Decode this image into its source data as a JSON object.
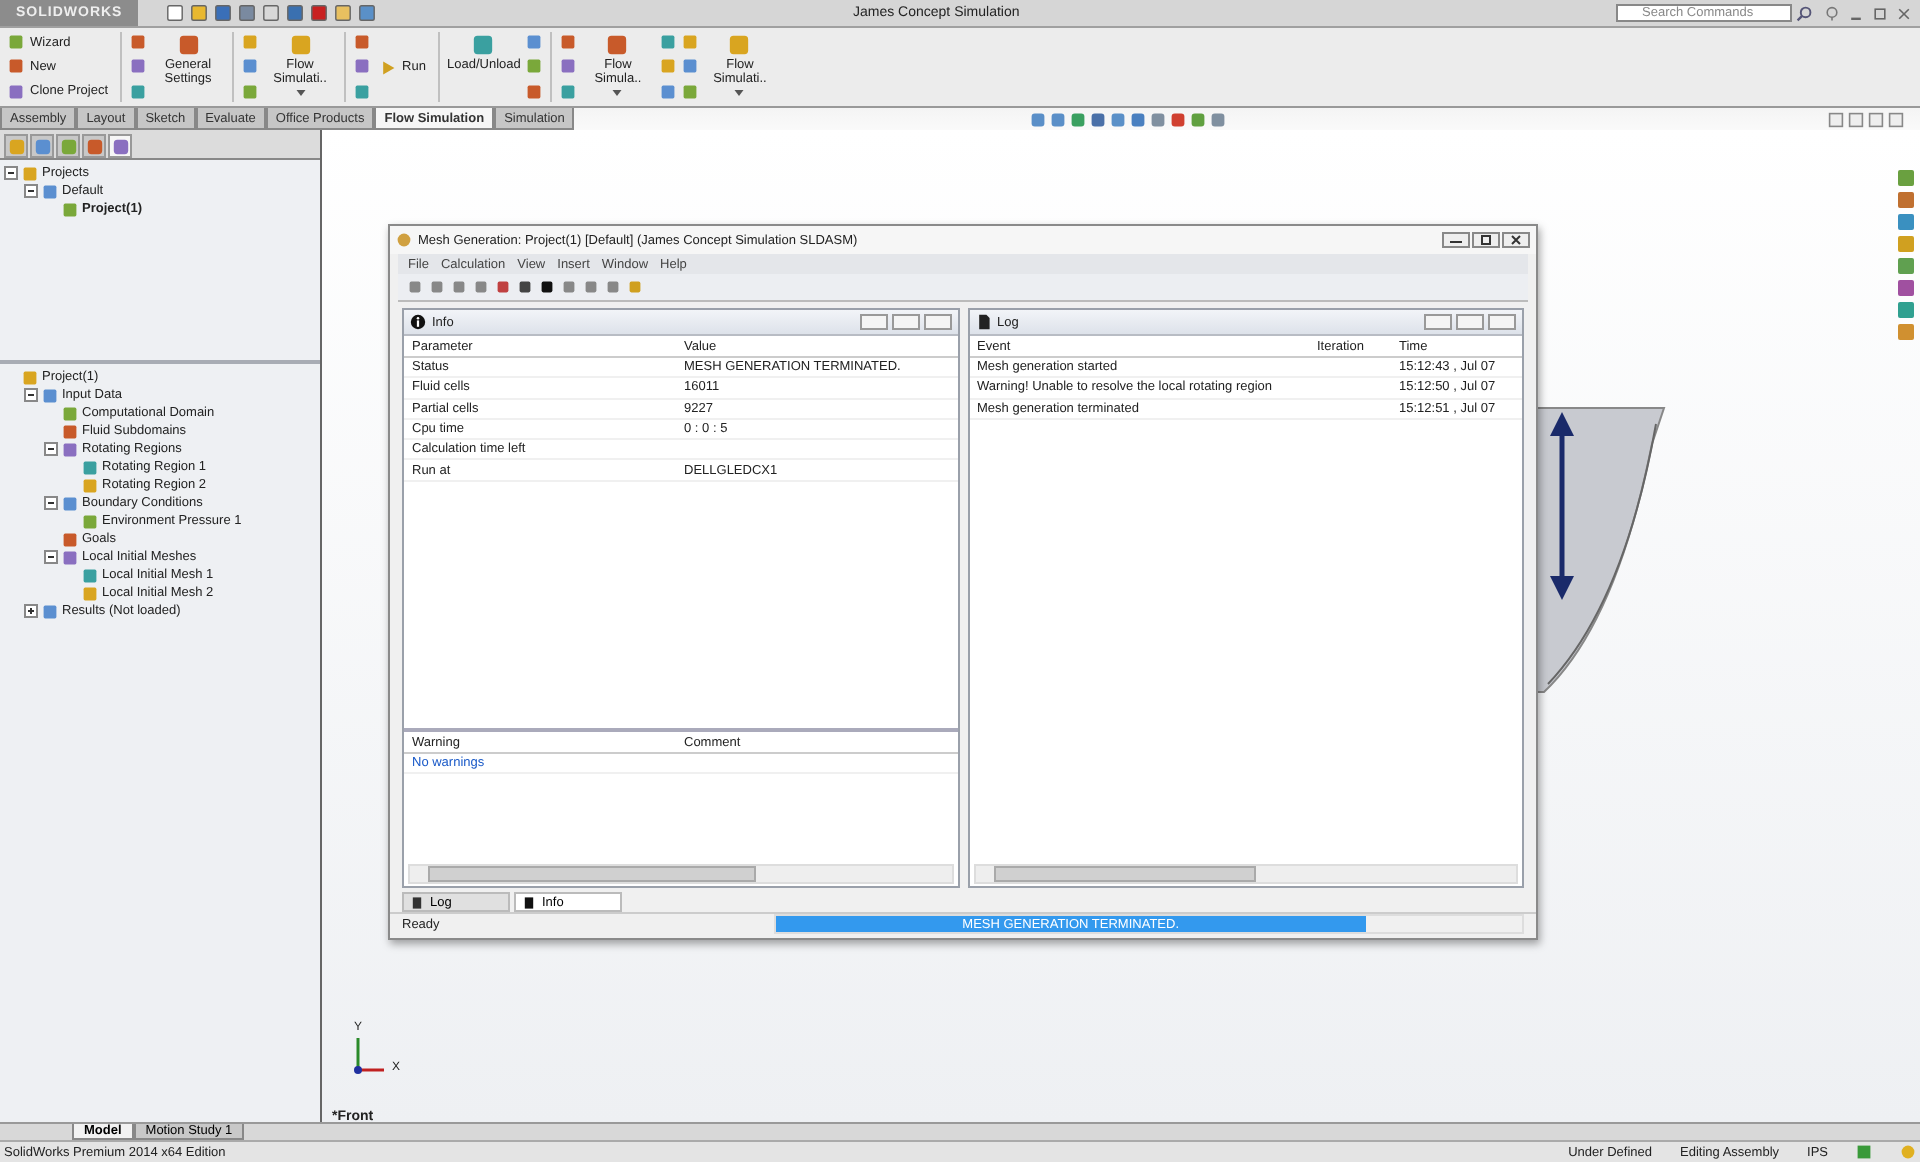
{
  "app": {
    "logo": "SOLIDWORKS",
    "title": "James Concept Simulation",
    "search_placeholder": "Search Commands"
  },
  "ribbon": [
    {
      "kind": "stack",
      "labels": [
        "Wizard",
        "New",
        "Clone Project"
      ]
    },
    {
      "kind": "separator"
    },
    {
      "kind": "icons"
    },
    {
      "kind": "large",
      "label": "General Settings",
      "dropdown": false
    },
    {
      "kind": "separator"
    },
    {
      "kind": "icons"
    },
    {
      "kind": "large",
      "label": "Flow Simulati..",
      "dropdown": true
    },
    {
      "kind": "separator"
    },
    {
      "kind": "icons"
    },
    {
      "kind": "small",
      "label": "Run"
    },
    {
      "kind": "separator"
    },
    {
      "kind": "large",
      "label": "Load/Unload",
      "dropdown": false
    },
    {
      "kind": "icons"
    },
    {
      "kind": "separator"
    },
    {
      "kind": "icons"
    },
    {
      "kind": "large",
      "label": "Flow Simula..",
      "dropdown": true
    },
    {
      "kind": "icons"
    },
    {
      "kind": "icons"
    },
    {
      "kind": "large",
      "label": "Flow Simulati..",
      "dropdown": true
    }
  ],
  "command_tabs": [
    {
      "label": "Assembly",
      "selected": false
    },
    {
      "label": "Layout",
      "selected": false
    },
    {
      "label": "Sketch",
      "selected": false
    },
    {
      "label": "Evaluate",
      "selected": false
    },
    {
      "label": "Office Products",
      "selected": false
    },
    {
      "label": "Flow Simulation",
      "selected": true
    },
    {
      "label": "Simulation",
      "selected": false
    }
  ],
  "feature_tabs": [
    {
      "selected": false
    },
    {
      "selected": false
    },
    {
      "selected": false
    },
    {
      "selected": false
    },
    {
      "selected": true
    }
  ],
  "project_tree": [
    {
      "label": "Projects",
      "expanded": true,
      "children": [
        {
          "label": "Default",
          "expanded": true,
          "children": [
            {
              "label": "Project(1)",
              "bold": true
            }
          ]
        }
      ]
    }
  ],
  "analysis_tree": [
    {
      "label": "Project(1)",
      "children": [
        {
          "label": "Input Data",
          "expanded": true,
          "children": [
            {
              "label": "Computational Domain"
            },
            {
              "label": "Fluid Subdomains"
            },
            {
              "label": "Rotating Regions",
              "expanded": true,
              "children": [
                {
                  "label": "Rotating Region 1"
                },
                {
                  "label": "Rotating Region 2"
                }
              ]
            },
            {
              "label": "Boundary Conditions",
              "expanded": true,
              "children": [
                {
                  "label": "Environment Pressure 1"
                }
              ]
            },
            {
              "label": "Goals"
            },
            {
              "label": "Local Initial Meshes",
              "expanded": true,
              "children": [
                {
                  "label": "Local Initial Mesh 1"
                },
                {
                  "label": "Local Initial Mesh 2"
                }
              ]
            }
          ]
        },
        {
          "label": "Results (Not loaded)",
          "expanded": false
        }
      ]
    }
  ],
  "dialog": {
    "title": "Mesh Generation: Project(1) [Default] (James Concept Simulation SLDASM)",
    "menu": [
      "File",
      "Calculation",
      "View",
      "Insert",
      "Window",
      "Help"
    ],
    "info": {
      "title": "Info",
      "columns": [
        "Parameter",
        "Value"
      ],
      "rows": [
        {
          "parameter": "Status",
          "value": "MESH GENERATION TERMINATED."
        },
        {
          "parameter": "Fluid cells",
          "value": "16011"
        },
        {
          "parameter": "Partial cells",
          "value": "9227"
        },
        {
          "parameter": "Cpu time",
          "value": "0 : 0 : 5"
        },
        {
          "parameter": "Calculation time left"
        },
        {
          "parameter": "Run at",
          "value": "DELLGLEDCX1"
        }
      ]
    },
    "warnings": {
      "columns": [
        "Warning",
        "Comment"
      ],
      "rows": [
        {
          "warning": "No warnings"
        }
      ]
    },
    "log": {
      "title": "Log",
      "columns": [
        "Event",
        "Iteration",
        "Time"
      ],
      "rows": [
        {
          "event": "Mesh generation started",
          "time": "15:12:43 , Jul 07"
        },
        {
          "event": "Warning! Unable to resolve the local rotating region",
          "time": "15:12:50 , Jul 07"
        },
        {
          "event": "Mesh generation terminated",
          "time": "15:12:51 , Jul 07"
        }
      ]
    },
    "tabs": [
      {
        "label": "Log",
        "selected": false
      },
      {
        "label": "Info",
        "selected": true
      }
    ],
    "status": "Ready",
    "progress": {
      "level": 0.79,
      "text": "MESH GENERATION TERMINATED."
    }
  },
  "graphics": {
    "view_label": "*Front",
    "axis_x": "X",
    "axis_y": "Y"
  },
  "model_tabs": [
    {
      "label": "Model",
      "selected": true
    },
    {
      "label": "Motion Study 1",
      "selected": false
    }
  ],
  "status_bar": {
    "edition": "SolidWorks Premium 2014 x64 Edition",
    "items": [
      "Under Defined",
      "Editing Assembly",
      "IPS"
    ]
  }
}
